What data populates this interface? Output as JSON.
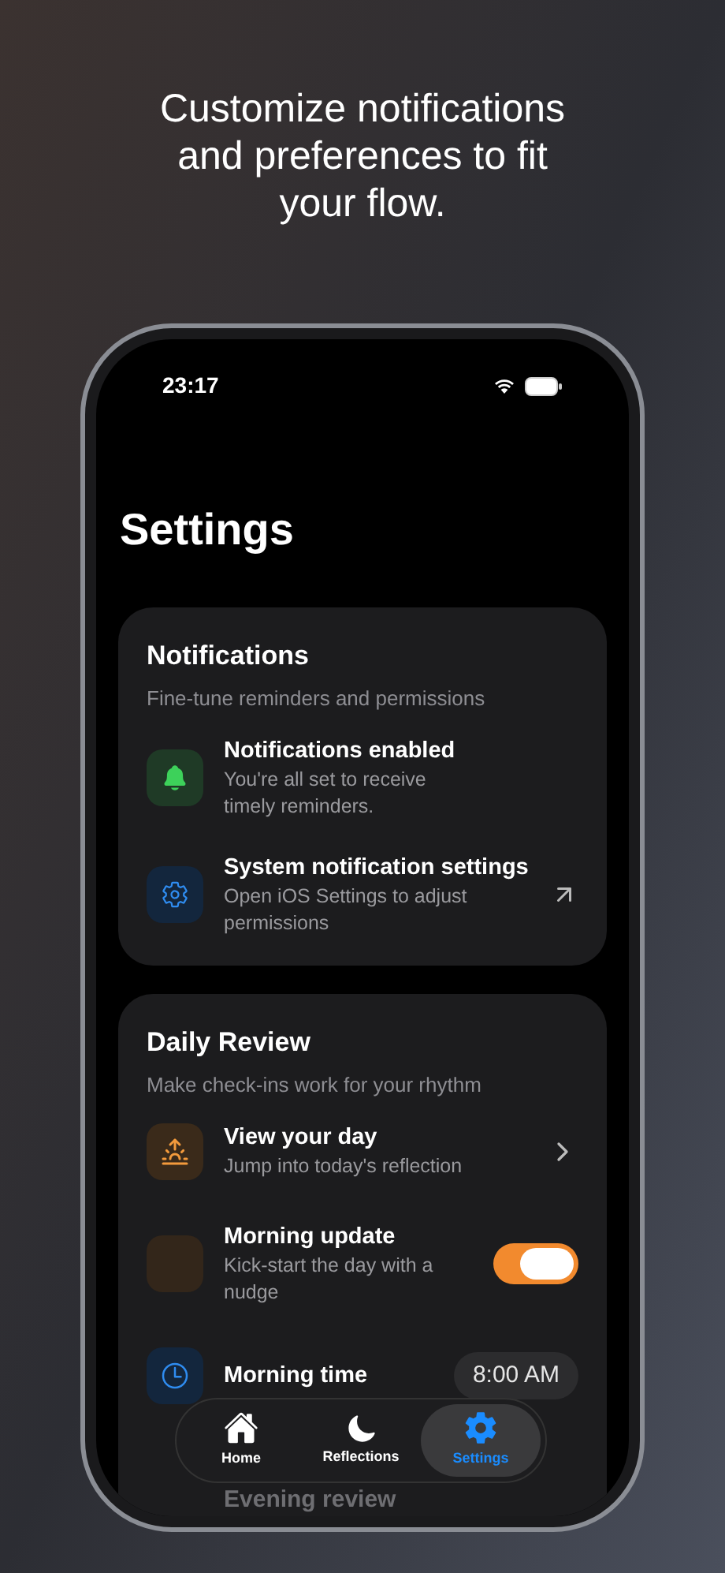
{
  "headline": "Customize notifications and preferences to fit your flow.",
  "status_bar": {
    "time": "23:17"
  },
  "title": "Settings",
  "sections": [
    {
      "title": "Notifications",
      "subtitle": "Fine-tune reminders and permissions",
      "rows": [
        {
          "kind": "status",
          "title": "Notifications enabled",
          "subtitle": "You're all set to receive timely reminders."
        },
        {
          "kind": "link",
          "title": "System notification settings",
          "subtitle": "Open iOS Settings to adjust permissions"
        }
      ]
    },
    {
      "title": "Daily Review",
      "subtitle": "Make check-ins work for your rhythm",
      "rows": [
        {
          "kind": "chevron",
          "title": "View your day",
          "subtitle": "Jump into today's reflection"
        },
        {
          "kind": "toggle",
          "title": "Morning update",
          "subtitle": "Kick-start the day with a nudge",
          "on": true
        },
        {
          "kind": "time",
          "title": "Morning time",
          "value": "8:00 AM"
        },
        {
          "kind": "faded",
          "title": "Evening review"
        }
      ]
    }
  ],
  "tab_bar": [
    {
      "label": "Home",
      "selected": false
    },
    {
      "label": "Reflections",
      "selected": false
    },
    {
      "label": "Settings",
      "selected": true
    }
  ]
}
